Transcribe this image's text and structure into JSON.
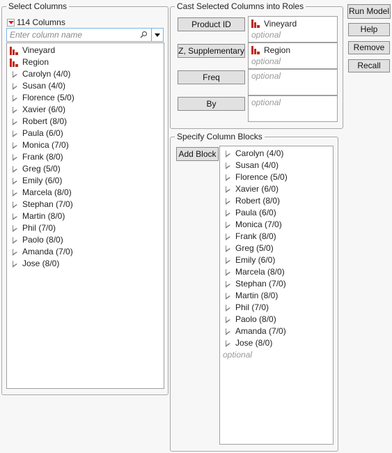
{
  "select_columns": {
    "title": "Select Columns",
    "count_label": "114 Columns",
    "search_placeholder": "Enter column name",
    "items": [
      {
        "label": "Vineyard",
        "type": "nominal"
      },
      {
        "label": "Region",
        "type": "nominal"
      },
      {
        "label": "Carolyn (4/0)",
        "type": "group"
      },
      {
        "label": "Susan (4/0)",
        "type": "group"
      },
      {
        "label": "Florence (5/0)",
        "type": "group"
      },
      {
        "label": "Xavier (6/0)",
        "type": "group"
      },
      {
        "label": "Robert (8/0)",
        "type": "group"
      },
      {
        "label": "Paula (6/0)",
        "type": "group"
      },
      {
        "label": "Monica (7/0)",
        "type": "group"
      },
      {
        "label": "Frank (8/0)",
        "type": "group"
      },
      {
        "label": "Greg (5/0)",
        "type": "group"
      },
      {
        "label": "Emily (6/0)",
        "type": "group"
      },
      {
        "label": "Marcela (8/0)",
        "type": "group"
      },
      {
        "label": "Stephan (7/0)",
        "type": "group"
      },
      {
        "label": "Martin (8/0)",
        "type": "group"
      },
      {
        "label": "Phil (7/0)",
        "type": "group"
      },
      {
        "label": "Paolo (8/0)",
        "type": "group"
      },
      {
        "label": "Amanda (7/0)",
        "type": "group"
      },
      {
        "label": "Jose (8/0)",
        "type": "group"
      }
    ]
  },
  "cast_roles": {
    "title": "Cast Selected Columns into Roles",
    "roles": [
      {
        "button": "Product ID",
        "value": "Vineyard",
        "placeholder": "optional"
      },
      {
        "button": "Z, Supplementary",
        "value": "Region",
        "placeholder": "optional"
      },
      {
        "button": "Freq",
        "value": "",
        "placeholder": "optional"
      },
      {
        "button": "By",
        "value": "",
        "placeholder": "optional"
      }
    ]
  },
  "column_blocks": {
    "title": "Specify Column Blocks",
    "add_block_label": "Add Block",
    "placeholder": "optional",
    "items": [
      "Carolyn (4/0)",
      "Susan (4/0)",
      "Florence (5/0)",
      "Xavier (6/0)",
      "Robert (8/0)",
      "Paula (6/0)",
      "Monica (7/0)",
      "Frank (8/0)",
      "Greg (5/0)",
      "Emily (6/0)",
      "Marcela (8/0)",
      "Stephan (7/0)",
      "Martin (8/0)",
      "Phil (7/0)",
      "Paolo (8/0)",
      "Amanda (7/0)",
      "Jose (8/0)"
    ]
  },
  "actions": {
    "run_model": "Run Model",
    "help": "Help",
    "remove": "Remove",
    "recall": "Recall"
  },
  "colors": {
    "nominal_icon": "#c0281b",
    "menu_triangle": "#d6202a",
    "search_border": "#7eb4ea"
  }
}
